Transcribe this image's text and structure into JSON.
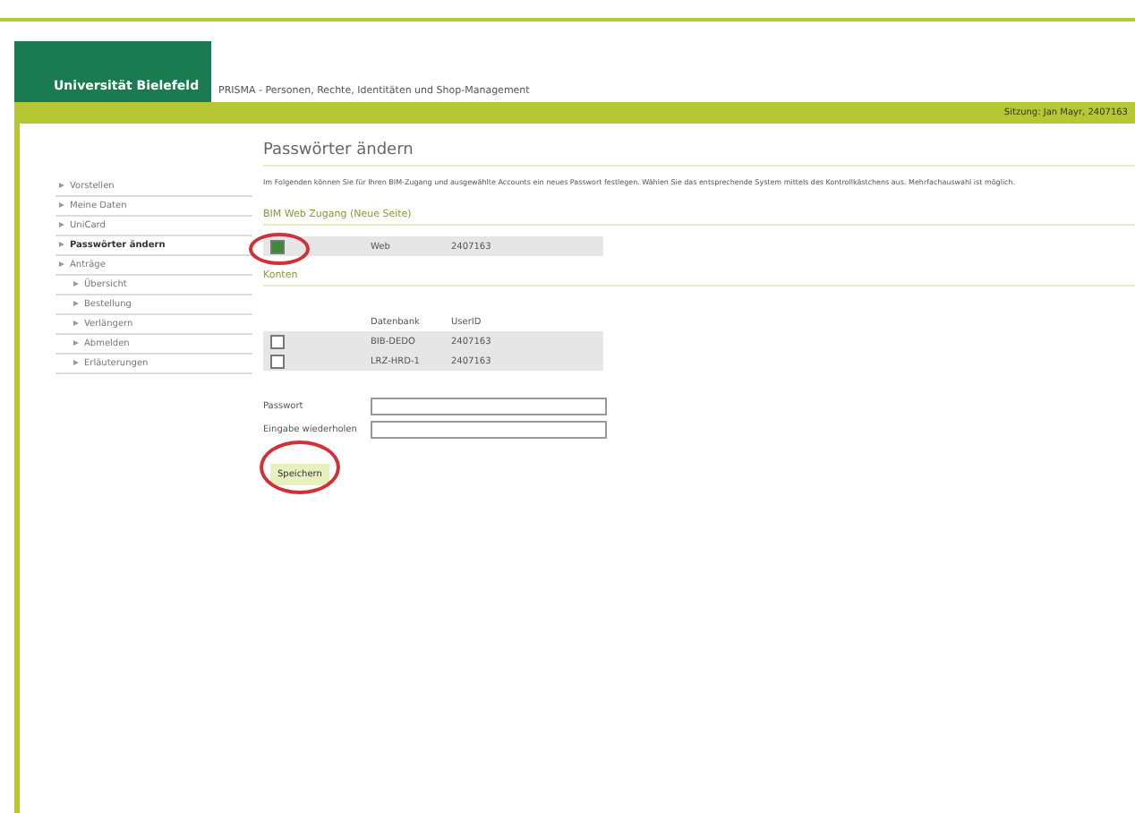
{
  "header": {
    "logo": "Universität Bielefeld",
    "title": "PRISMA - Personen, Rechte, Identitäten und Shop-Management",
    "user": "Sitzung: Jan Mayr, 2407163"
  },
  "sidebar": {
    "items": [
      {
        "label": "Vorstellen",
        "selected": false
      },
      {
        "label": "Meine Daten",
        "selected": false
      },
      {
        "label": "UniCard",
        "selected": false
      },
      {
        "label": "Passwörter ändern",
        "selected": true
      },
      {
        "label": "Anträge",
        "selected": false,
        "children": [
          {
            "label": "Übersicht",
            "selected": false
          },
          {
            "label": "Bestellung",
            "selected": false
          },
          {
            "label": "Verlängern",
            "selected": false
          },
          {
            "label": "Abmelden",
            "selected": false
          },
          {
            "label": "Erläuterungen",
            "selected": false
          }
        ]
      }
    ]
  },
  "page": {
    "heading": "Passwörter ändern",
    "intro": "Im Folgenden können Sie für Ihren BIM-Zugang und ausgewählte Accounts ein neues Passwort festlegen. Wählen Sie das entsprechende System mittels des Kontrollkästchens aus. Mehrfachauswahl ist möglich.",
    "web_section": {
      "title": "BIM Web Zugang (Neue Seite)",
      "rows": [
        {
          "checked": true,
          "highlighted": true,
          "system": "Web",
          "user_id": "2407163"
        }
      ]
    },
    "accounts_section": {
      "title": "Konten",
      "columns": [
        "Datenbank",
        "UserID"
      ],
      "rows": [
        {
          "checked": false,
          "highlighted": false,
          "system": "BIB-DEDO",
          "user_id": "2407163"
        },
        {
          "checked": false,
          "highlighted": false,
          "system": "LRZ-HRD-1",
          "user_id": "2407163"
        }
      ]
    },
    "fields": [
      {
        "label": "Passwort"
      },
      {
        "label": "Eingabe wiederholen"
      }
    ],
    "save_button": {
      "label": "Speichern",
      "highlighted": true
    }
  }
}
